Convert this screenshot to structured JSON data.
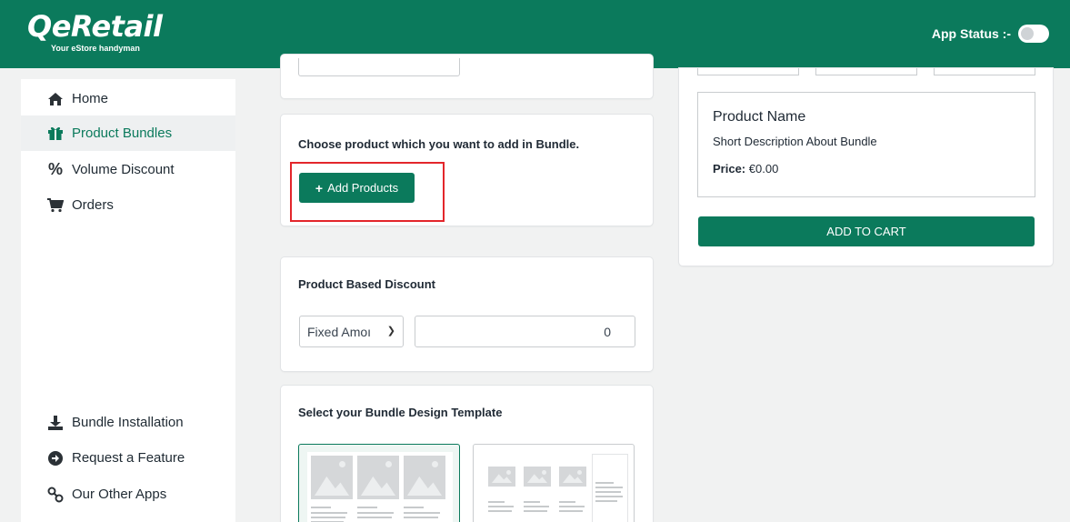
{
  "header": {
    "logo_text": "QeRetail",
    "logo_tagline": "Your eStore handyman",
    "app_status_label": "App Status :-"
  },
  "sidebar": {
    "items": [
      {
        "label": "Home",
        "icon": "home-icon"
      },
      {
        "label": "Product Bundles",
        "icon": "gift-icon",
        "active": true
      },
      {
        "label": "Volume Discount",
        "icon": "percent-icon"
      },
      {
        "label": "Orders",
        "icon": "cart-icon"
      }
    ],
    "bottom_items": [
      {
        "label": "Bundle Installation",
        "icon": "download-icon"
      },
      {
        "label": "Request a Feature",
        "icon": "arrow-circle-icon"
      },
      {
        "label": "Our Other Apps",
        "icon": "link-icon"
      }
    ]
  },
  "choose_product": {
    "title": "Choose product which you want to add in Bundle.",
    "button_label": "Add Products"
  },
  "discount": {
    "title": "Product Based Discount",
    "type_value": "Fixed Amoı",
    "amount_value": "0"
  },
  "template": {
    "title": "Select your Bundle Design Template"
  },
  "preview": {
    "product_name": "Product Name",
    "description": "Short Description About Bundle",
    "price_label": "Price:",
    "price_value": "€0.00",
    "cart_button": "ADD TO CART"
  },
  "colors": {
    "brand": "#0b7a5c",
    "highlight": "#e3262b"
  }
}
